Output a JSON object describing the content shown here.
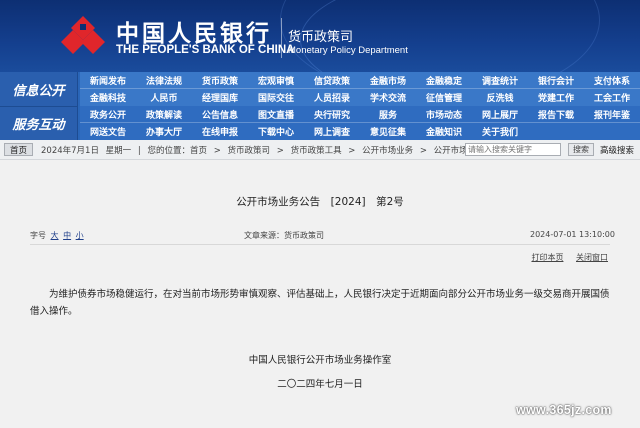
{
  "header": {
    "bank_name_cn": "中国人民银行",
    "bank_name_en": "THE PEOPLE'S BANK OF CHINA",
    "dept_cn": "货币政策司",
    "dept_en": "Monetary Policy Department"
  },
  "nav": {
    "info_label": "信息公开",
    "service_label": "服务互动",
    "info_items": [
      "新闻发布",
      "法律法规",
      "货币政策",
      "宏观审慎",
      "信贷政策",
      "金融市场",
      "金融稳定",
      "调查统计",
      "银行会计",
      "支付体系",
      "金融科技",
      "人民币",
      "经理国库",
      "国际交往",
      "人员招录",
      "学术交流",
      "征信管理",
      "反洗钱",
      "党建工作",
      "工会工作"
    ],
    "service_items": [
      "政务公开",
      "政策解读",
      "公告信息",
      "图文直播",
      "央行研究",
      "服务",
      "市场动态",
      "网上展厅",
      "报告下载",
      "报刊年鉴",
      "网送文告",
      "办事大厅",
      "在线申报",
      "下载中心",
      "网上调查",
      "意见征集",
      "金融知识",
      "关于我们",
      "",
      ""
    ]
  },
  "breadcrumb": {
    "home": "首页",
    "date": "2024年7月1日",
    "weekday": "星期一",
    "location_prefix": "您的位置：首页",
    "path": [
      "货币政策司",
      "货币政策工具",
      "公开市场业务",
      "公开市场业务公告"
    ],
    "separator": ">"
  },
  "search": {
    "placeholder": "请输入搜索关键字",
    "button": "搜索",
    "advanced": "高级搜索"
  },
  "article": {
    "title": "公开市场业务公告　[2024]　第2号",
    "font_label": "字号",
    "font_sizes": [
      "大",
      "中",
      "小"
    ],
    "source": "文章来源：货币政策司",
    "datetime": "2024-07-01  13:10:00",
    "print_label": "打印本页",
    "close_label": "关闭窗口",
    "body": "为维护债券市场稳健运行，在对当前市场形势审慎观察、评估基础上，人民银行决定于近期面向部分公开市场业务一级交易商开展国债借入操作。",
    "signature_org": "中国人民银行公开市场业务操作室",
    "signature_date": "二〇二四年七月一日"
  },
  "watermark": "www.365jz.com"
}
